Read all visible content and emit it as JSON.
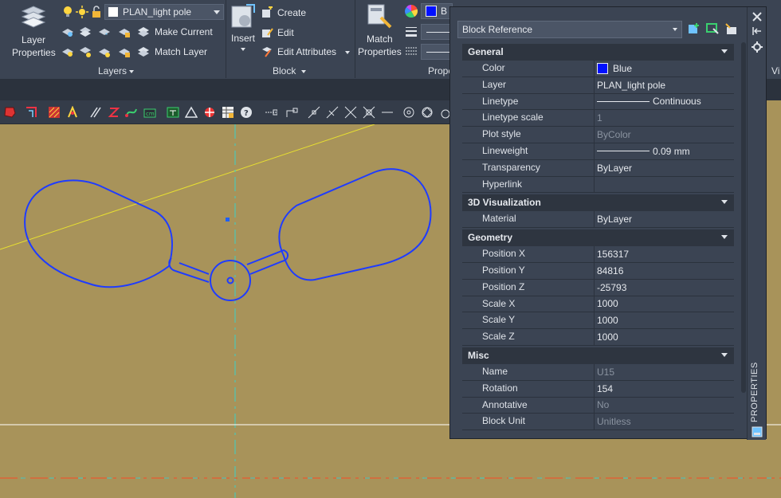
{
  "ribbon": {
    "layers": {
      "properties_label_1": "Layer",
      "properties_label_2": "Properties",
      "current_layer": "PLAN_light pole",
      "make_current": "Make Current",
      "match_layer": "Match Layer",
      "panel_title": "Layers"
    },
    "block": {
      "insert_label": "Insert",
      "create": "Create",
      "edit": "Edit",
      "edit_attributes": "Edit Attributes",
      "panel_title": "Block"
    },
    "properties": {
      "match_label_1": "Match",
      "match_label_2": "Properties",
      "color_partial": "B",
      "panel_title": "Prope"
    },
    "view_partial": "Vi"
  },
  "palette": {
    "object_type": "Block Reference",
    "side_title": "PROPERTIES",
    "sections": [
      {
        "title": "General",
        "rows": [
          {
            "key": "Color",
            "value": "Blue",
            "kind": "swatch"
          },
          {
            "key": "Layer",
            "value": "PLAN_light pole"
          },
          {
            "key": "Linetype",
            "value": "Continuous",
            "kind": "line"
          },
          {
            "key": "Linetype scale",
            "value": "1",
            "dim": true
          },
          {
            "key": "Plot style",
            "value": "ByColor",
            "dim": true
          },
          {
            "key": "Lineweight",
            "value": "0.09 mm",
            "kind": "line"
          },
          {
            "key": "Transparency",
            "value": "ByLayer"
          },
          {
            "key": "Hyperlink",
            "value": ""
          }
        ]
      },
      {
        "title": "3D Visualization",
        "rows": [
          {
            "key": "Material",
            "value": "ByLayer"
          }
        ]
      },
      {
        "title": "Geometry",
        "rows": [
          {
            "key": "Position X",
            "value": "156317"
          },
          {
            "key": "Position Y",
            "value": "84816"
          },
          {
            "key": "Position Z",
            "value": "-25793"
          },
          {
            "key": "Scale X",
            "value": "1000"
          },
          {
            "key": "Scale Y",
            "value": "1000"
          },
          {
            "key": "Scale Z",
            "value": "1000"
          }
        ]
      },
      {
        "title": "Misc",
        "rows": [
          {
            "key": "Name",
            "value": "U15",
            "dim": true
          },
          {
            "key": "Rotation",
            "value": "154"
          },
          {
            "key": "Annotative",
            "value": "No",
            "dim": true
          },
          {
            "key": "Block Unit",
            "value": "Unitless",
            "dim": true
          }
        ]
      }
    ]
  },
  "colors": {
    "canvas": "#a8935a",
    "entity": "#1f3cff",
    "ribbon": "#3b4453",
    "swatch": "#0010ff"
  }
}
